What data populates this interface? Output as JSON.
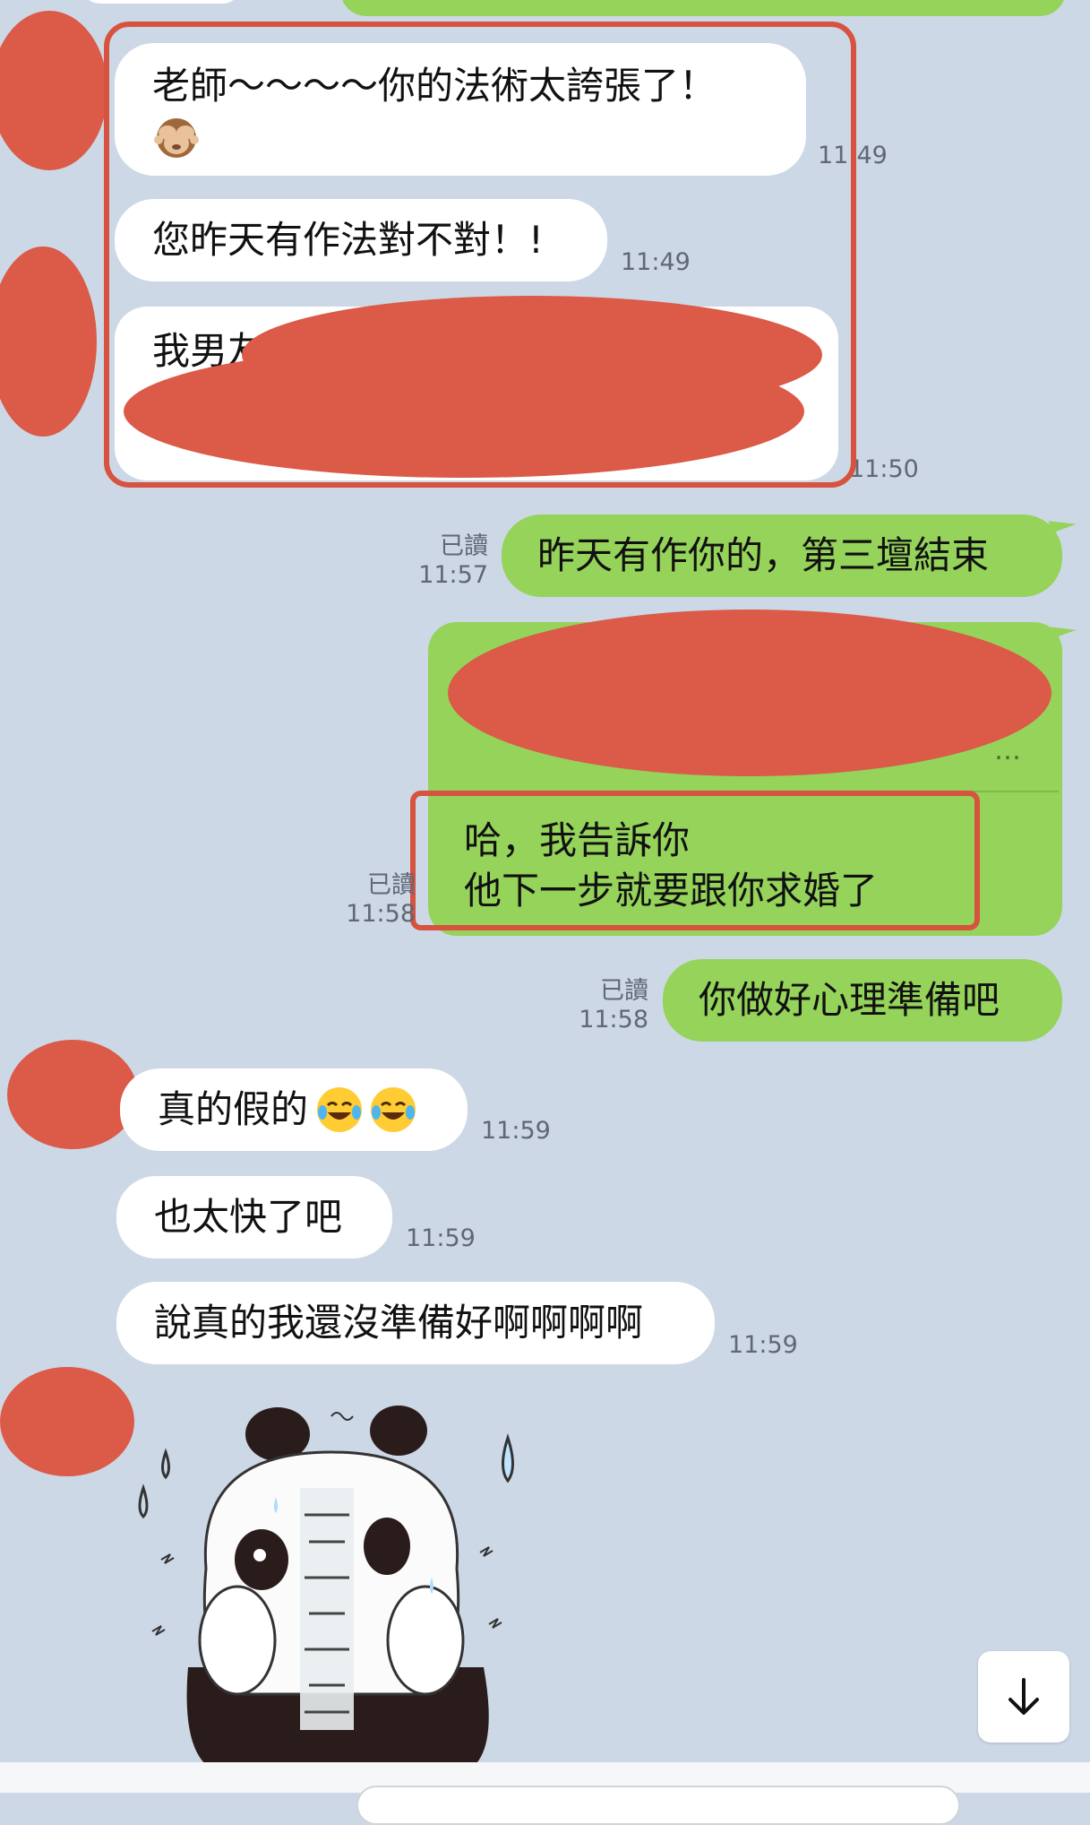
{
  "messages": {
    "m1_text": "老師～～～～你的法術太誇張了！",
    "m1_time": "11:49",
    "m2_text": "您昨天有作法對不對！!",
    "m2_time": "11:49",
    "m3_text_visible": "我男友",
    "m3_time": "11:50",
    "m4_read": "已讀",
    "m4_time": "11:57",
    "m4_text": "昨天有作你的，第三壇結束",
    "m5_quote_tail": "…",
    "m5_line1": "哈，我告訴你",
    "m5_line2": "他下一步就要跟你求婚了",
    "m5_read": "已讀",
    "m5_time": "11:58",
    "m6_read": "已讀",
    "m6_time": "11:58",
    "m6_text": "你做好心理準備吧",
    "m7_text": "真的假的",
    "m7_time": "11:59",
    "m8_text": "也太快了吧",
    "m8_time": "11:59",
    "m9_text": "說真的我還沒準備好啊啊啊啊",
    "m9_time": "11:59"
  },
  "icons": {
    "monkey": "see-no-evil-monkey-emoji",
    "laugh": "tears-of-joy-emoji",
    "scroll": "arrow-down-icon",
    "sticker": "sweating-panda-sticker"
  },
  "colors": {
    "background": "#ccd8e5",
    "incoming": "#ffffff",
    "outgoing": "#95d35a",
    "highlight": "#d7523f",
    "redaction": "#db5a48"
  }
}
